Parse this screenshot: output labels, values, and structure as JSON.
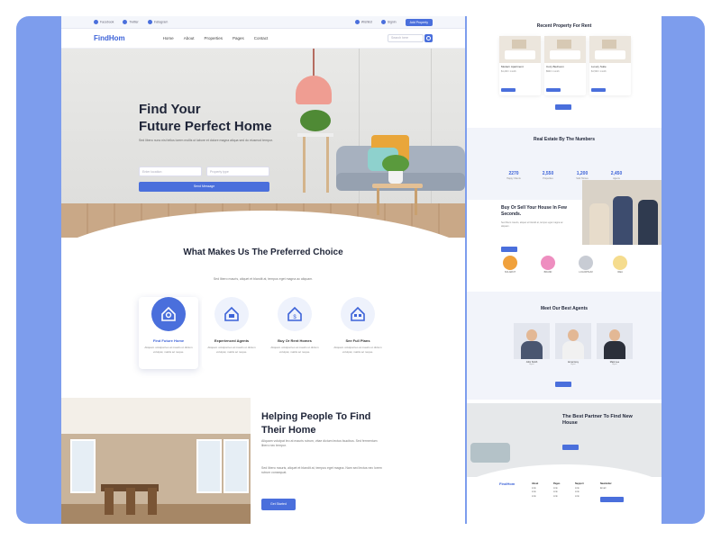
{
  "topbar": {
    "items": [
      "Facebook",
      "Twitter",
      "Instagram"
    ],
    "links": [
      "Wishlist",
      "Signin"
    ],
    "cta": "Add Property"
  },
  "nav": {
    "logo": "FindHom",
    "items": [
      "Home",
      "About",
      "Properties",
      "Pages",
      "Contact"
    ],
    "search_placeholder": "Search here"
  },
  "hero": {
    "title_line1": "Find Your",
    "title_line2": "Future Perfect Home",
    "description": "Sed libero nunc nisi tellus lorem mollis ut labore et dolore magna aliqua sed do eiusmod tempor.",
    "input1_placeholder": "Enter location",
    "input2_placeholder": "Property type",
    "button": "Send Message"
  },
  "choice": {
    "title": "What Makes Us The Preferred Choice",
    "subtitle": "Sed libero mauris, aliquet et blandit at, tempus eget magna ac aliquam.",
    "cards": [
      {
        "title": "Find Future Home",
        "desc": "Aliquam volutpat leo at mauris ut dictum volutpat, mattis ac neque."
      },
      {
        "title": "Experienced Agents",
        "desc": "Aliquam volutpat leo at mauris ut dictum volutpat, mattis ac neque."
      },
      {
        "title": "Buy Or Rent Homes",
        "desc": "Aliquam volutpat leo at mauris ut dictum volutpat, mattis ac neque."
      },
      {
        "title": "See Full Plans",
        "desc": "Aliquam volutpat leo at mauris ut dictum volutpat, mattis ac neque."
      }
    ]
  },
  "help": {
    "title_line1": "Helping People To Find",
    "title_line2": "Their Home",
    "para1": "Aliquam volutpat leo at mauris rutrum, vitae dictum lectus faucibus. Sed fermentum libero nec tempor.",
    "para2": "Sed libero mauris, aliquet et blandit at, tempus eget magna. Nam sed lectus nec lorem rutrum consequat.",
    "button": "Get Started"
  },
  "right": {
    "recent_title": "Recent Property For Rent",
    "properties": [
      {
        "name": "Modern Apartment",
        "price": "$1,200 / month"
      },
      {
        "name": "Cozy Bedroom",
        "price": "$900 / month"
      },
      {
        "name": "Luxury Suite",
        "price": "$1,500 / month"
      }
    ],
    "numbers_title": "Real Estate By The Numbers",
    "stats": [
      {
        "value": "2270",
        "label": "Happy Clients"
      },
      {
        "value": "2,550",
        "label": "Properties"
      },
      {
        "value": "1,200",
        "label": "Sold Homes"
      },
      {
        "value": "2,450",
        "label": "Agents"
      }
    ],
    "buy_title": "Buy Or Sell Your House In Few Seconds.",
    "buy_text": "Sed libero mauris, aliquet et blandit at, tempus eget magna ac aliquam.",
    "logos": [
      "SOLARKIT",
      "BRAND",
      "LOGOIPSUM",
      "IDEA"
    ],
    "agents_title": "Meet Our Best Agents",
    "agents": [
      {
        "name": "John Smith",
        "role": "Agent"
      },
      {
        "name": "Anna Grey",
        "role": "Agent"
      },
      {
        "name": "Mark Lee",
        "role": "Agent"
      }
    ],
    "cta_title": "The Best Partner To Find New House",
    "footer_logo": "FindHom",
    "footer_cols": [
      {
        "title": "About",
        "items": [
          "Link",
          "Link",
          "Link"
        ]
      },
      {
        "title": "Pages",
        "items": [
          "Link",
          "Link",
          "Link"
        ]
      },
      {
        "title": "Support",
        "items": [
          "Link",
          "Link",
          "Link"
        ]
      },
      {
        "title": "Newsletter",
        "items": [
          "Email"
        ]
      }
    ]
  },
  "colors": {
    "accent": "#4a6fdc",
    "background": "#7d9ded"
  }
}
